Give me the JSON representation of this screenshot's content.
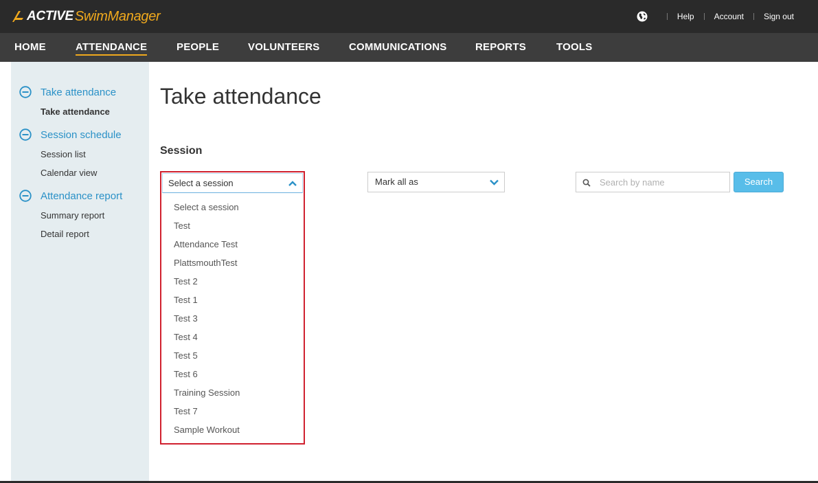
{
  "brand": {
    "active": "ACTIVE",
    "product": "SwimManager",
    "accent_color": "#f0a91d"
  },
  "utility_nav": {
    "globe_icon": "globe-icon",
    "help": "Help",
    "account": "Account",
    "sign_out": "Sign out"
  },
  "main_nav": [
    {
      "label": "HOME",
      "active": false
    },
    {
      "label": "ATTENDANCE",
      "active": true
    },
    {
      "label": "PEOPLE",
      "active": false
    },
    {
      "label": "VOLUNTEERS",
      "active": false
    },
    {
      "label": "COMMUNICATIONS",
      "active": false
    },
    {
      "label": "REPORTS",
      "active": false
    },
    {
      "label": "TOOLS",
      "active": false
    }
  ],
  "sidebar": {
    "sections": [
      {
        "title": "Take attendance",
        "icon": "minus-circle-icon",
        "items": [
          "Take attendance"
        ]
      },
      {
        "title": "Session schedule",
        "icon": "minus-circle-icon",
        "items": [
          "Session list",
          "Calendar view"
        ]
      },
      {
        "title": "Attendance report",
        "icon": "minus-circle-icon",
        "items": [
          "Summary report",
          "Detail report"
        ]
      }
    ],
    "active_item": "Take attendance"
  },
  "main": {
    "title": "Take attendance",
    "session_label": "Session",
    "session_select": {
      "selected": "Select a session",
      "expanded": true,
      "options": [
        "Select a session",
        "Test",
        "Attendance Test",
        "PlattsmouthTest",
        "Test 2",
        "Test 1",
        "Test 3",
        "Test 4",
        "Test 5",
        "Test 6",
        "Training Session",
        "Test 7",
        "Sample Workout"
      ]
    },
    "mark_all": {
      "selected": "Mark all as"
    },
    "search": {
      "placeholder": "Search by name",
      "value": "",
      "button": "Search"
    }
  },
  "colors": {
    "link_blue": "#2a91c7",
    "search_button": "#58bde9",
    "highlight_red": "#d0202e",
    "sidebar_bg": "#e5edf0"
  }
}
